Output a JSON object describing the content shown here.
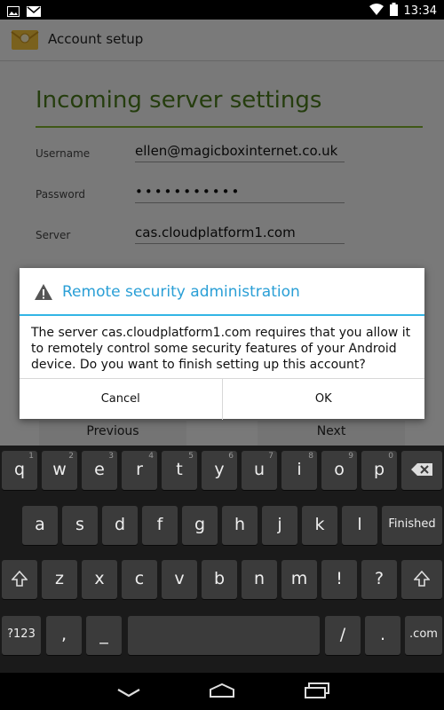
{
  "status_bar": {
    "time": "13:34"
  },
  "app_bar": {
    "title": "Account setup"
  },
  "page": {
    "heading": "Incoming server settings",
    "fields": [
      {
        "label": "Username",
        "value": "ellen@magicboxinternet.co.uk"
      },
      {
        "label": "Password",
        "value": "•••••••••••"
      },
      {
        "label": "Server",
        "value": "cas.cloudplatform1.com"
      }
    ],
    "previous_label": "Previous",
    "next_label": "Next"
  },
  "dialog": {
    "title": "Remote security administration",
    "message": "The server cas.cloudplatform1.com requires that you allow it to remotely control some security features of your Android device. Do you want to finish setting up this account?",
    "cancel_label": "Cancel",
    "ok_label": "OK"
  },
  "keyboard": {
    "row1": [
      {
        "k": "q",
        "h": "1"
      },
      {
        "k": "w",
        "h": "2"
      },
      {
        "k": "e",
        "h": "3"
      },
      {
        "k": "r",
        "h": "4"
      },
      {
        "k": "t",
        "h": "5"
      },
      {
        "k": "y",
        "h": "6"
      },
      {
        "k": "u",
        "h": "7"
      },
      {
        "k": "i",
        "h": "8"
      },
      {
        "k": "o",
        "h": "9"
      },
      {
        "k": "p",
        "h": "0"
      }
    ],
    "row2": [
      "a",
      "s",
      "d",
      "f",
      "g",
      "h",
      "j",
      "k",
      "l"
    ],
    "row3": [
      {
        "k": "z",
        "h": ""
      },
      {
        "k": "x",
        "h": ""
      },
      {
        "k": "c",
        "h": ""
      },
      {
        "k": "v",
        "h": ""
      },
      {
        "k": "b",
        "h": ""
      },
      {
        "k": "n",
        "h": ""
      },
      {
        "k": "m",
        "h": ""
      },
      {
        "k": "!",
        "h": ""
      },
      {
        "k": "?",
        "h": ""
      }
    ],
    "enter_label": "Finished",
    "symbols_label": "?123",
    "comma": ",",
    "underscore": "_",
    "slash": "/",
    "period": ".",
    "dotcom_label": ".com"
  },
  "colors": {
    "accent": "#33b5e5",
    "heading": "#4b7b1d",
    "rule": "#7fb02e"
  },
  "icons": [
    "picture-icon",
    "gmail-icon",
    "wifi-icon",
    "battery-icon",
    "email-app-icon",
    "warning-icon",
    "backspace-icon",
    "shift-icon",
    "back-icon",
    "home-icon",
    "recents-icon"
  ]
}
